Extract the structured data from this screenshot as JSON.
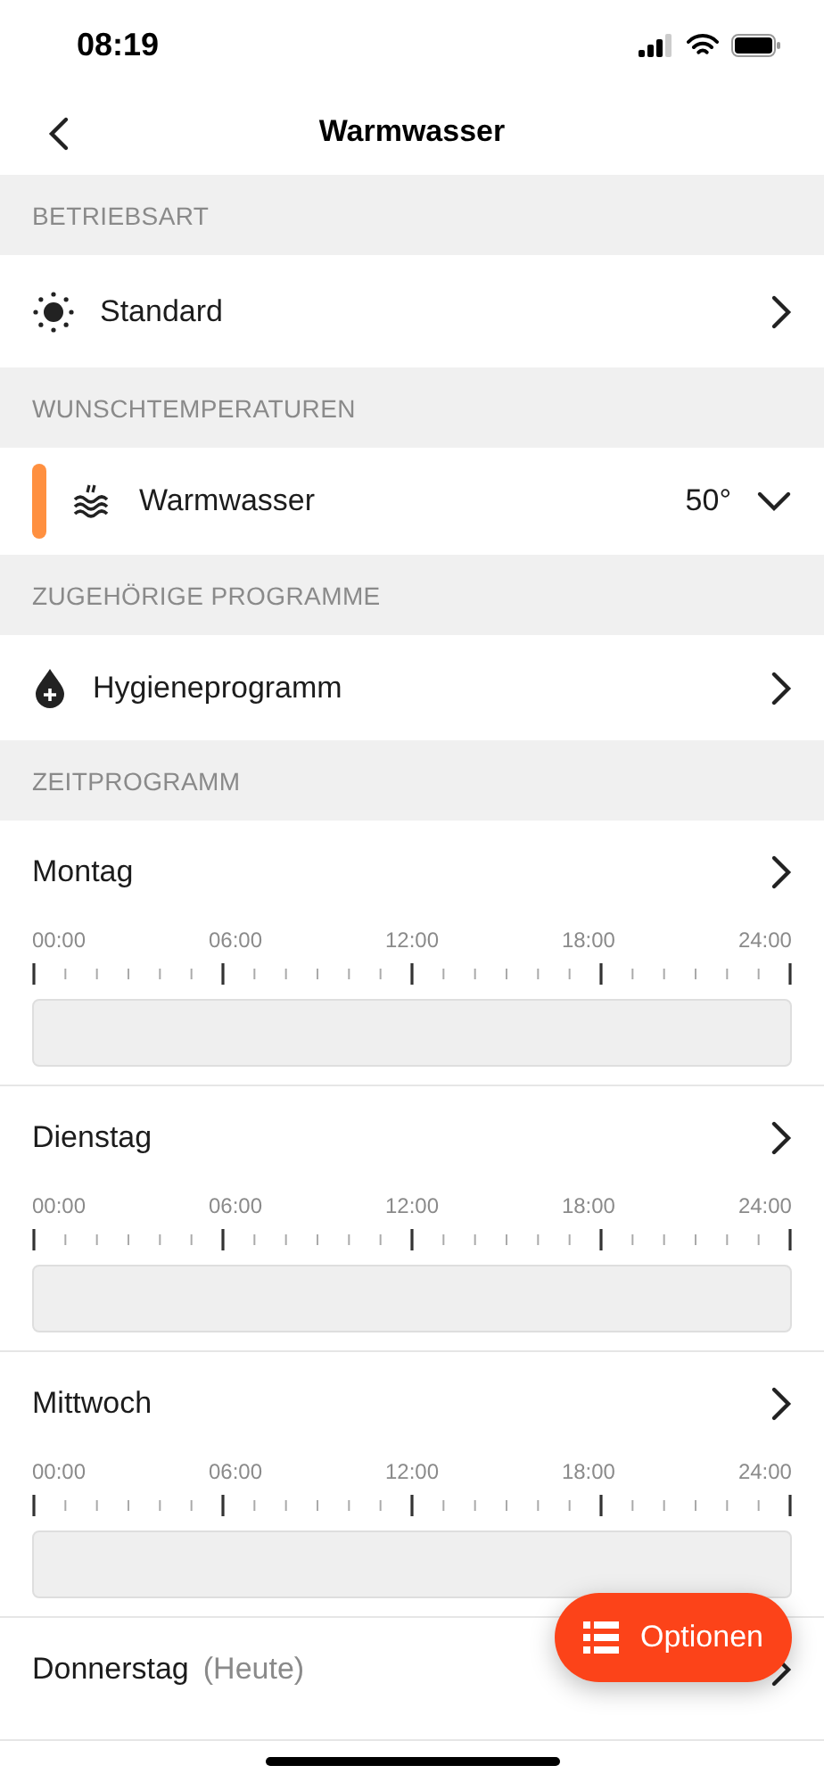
{
  "status_bar": {
    "time": "08:19"
  },
  "nav": {
    "title": "Warmwasser"
  },
  "sections": [
    {
      "header": "BETRIEBSART",
      "rows": [
        {
          "kind": "mode",
          "label": "Standard"
        }
      ]
    },
    {
      "header": "WUNSCHTEMPERATUREN",
      "rows": [
        {
          "kind": "temperature",
          "label": "Warmwasser",
          "value": "50°",
          "expanded": false
        }
      ]
    },
    {
      "header": "ZUGEHÖRIGE PROGRAMME",
      "rows": [
        {
          "kind": "program",
          "label": "Hygieneprogramm"
        }
      ]
    }
  ],
  "schedule": {
    "header": "ZEITPROGRAMM",
    "days": [
      {
        "name": "Montag",
        "scale": [
          "00:00",
          "06:00",
          "12:00",
          "18:00",
          "24:00"
        ]
      },
      {
        "name": "Dienstag",
        "scale": [
          "00:00",
          "06:00",
          "12:00",
          "18:00",
          "24:00"
        ]
      },
      {
        "name": "Mittwoch",
        "scale": [
          "00:00",
          "06:00",
          "12:00",
          "18:00",
          "24:00"
        ]
      },
      {
        "name": "Donnerstag",
        "note": "(Heute)"
      }
    ]
  },
  "fab": {
    "label": "Optionen"
  }
}
